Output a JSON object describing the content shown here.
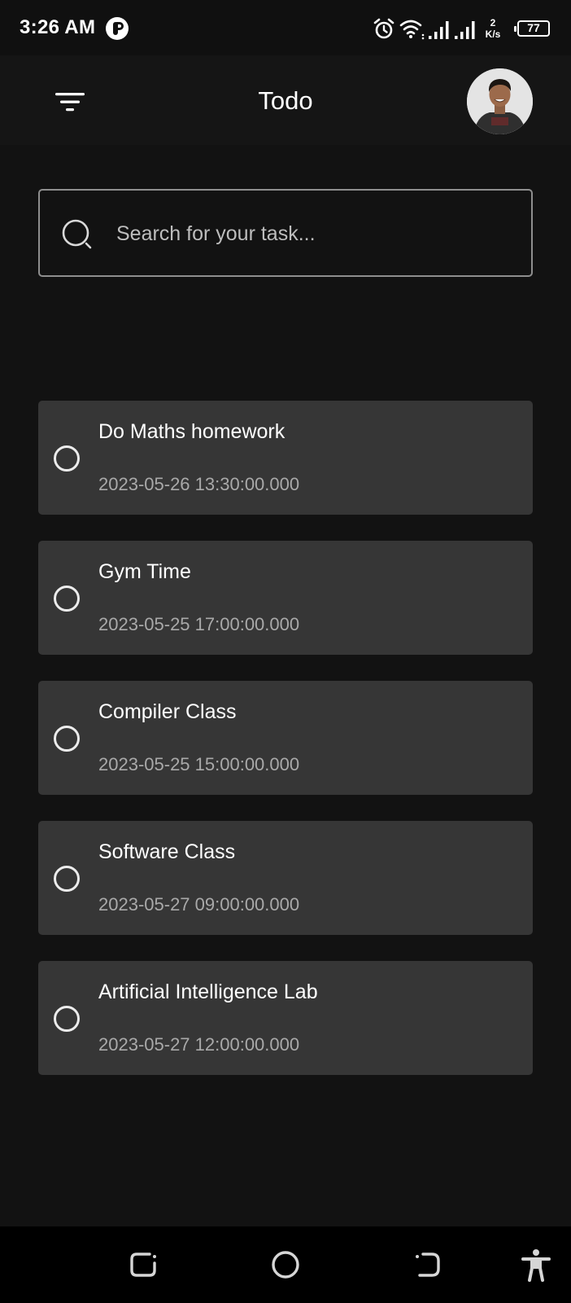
{
  "status_bar": {
    "time": "3:26 AM",
    "netspeed_value": "2",
    "netspeed_unit": "K/s",
    "battery": "77",
    "icons": [
      "app-notification-icon",
      "alarm-icon",
      "wifi-icon",
      "signal-icon",
      "signal-icon",
      "battery-icon"
    ]
  },
  "app_bar": {
    "title": "Todo",
    "menu_icon": "filter-menu-icon",
    "avatar": "user-avatar"
  },
  "search": {
    "placeholder": "Search for your task...",
    "value": ""
  },
  "tasks": [
    {
      "title": "Do Maths homework",
      "datetime": "2023-05-26 13:30:00.000",
      "completed": false
    },
    {
      "title": "Gym Time",
      "datetime": "2023-05-25 17:00:00.000",
      "completed": false
    },
    {
      "title": "Compiler Class",
      "datetime": "2023-05-25 15:00:00.000",
      "completed": false
    },
    {
      "title": "Software Class",
      "datetime": "2023-05-27 09:00:00.000",
      "completed": false
    },
    {
      "title": "Artificial Intelligence Lab",
      "datetime": "2023-05-27 12:00:00.000",
      "completed": false
    }
  ],
  "nav_bar": {
    "buttons": [
      "recents-icon",
      "home-icon",
      "back-icon",
      "accessibility-icon"
    ]
  },
  "colors": {
    "background": "#121212",
    "card": "#363636",
    "text": "#ffffff",
    "secondary_text": "#a9a9a9"
  }
}
